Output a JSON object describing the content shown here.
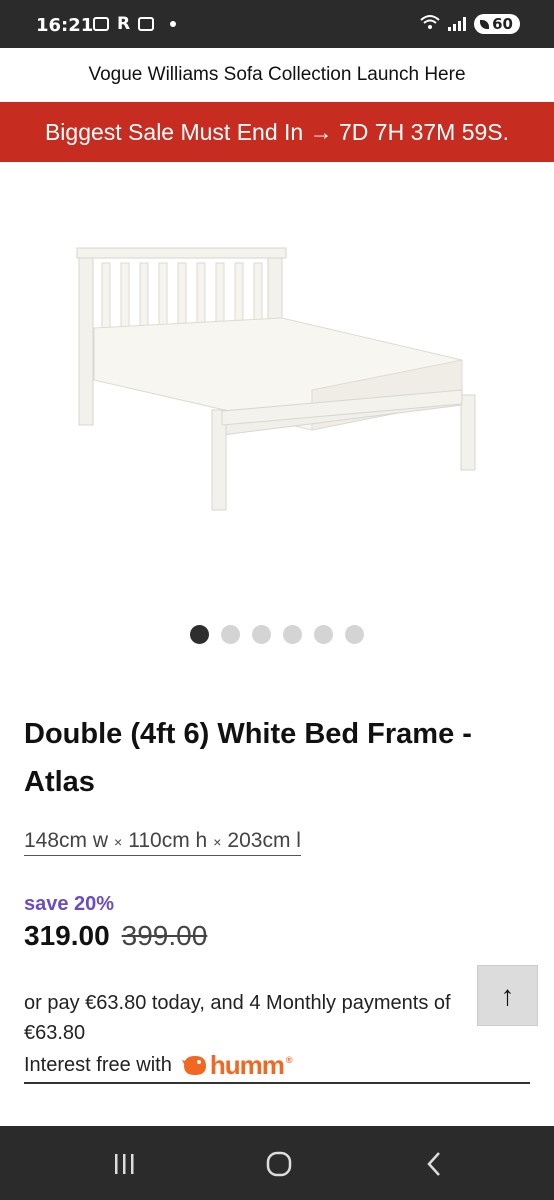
{
  "status_bar": {
    "time": "16:21",
    "r_label": "R",
    "battery": "60"
  },
  "announcement": "Vogue Williams Sofa Collection Launch Here",
  "sale_banner": "Biggest Sale Must End In → 7D 7H 37M 59S.",
  "carousel": {
    "slides": 6,
    "active": 1
  },
  "product": {
    "title": "Double (4ft 6) White Bed Frame - Atlas",
    "dims": {
      "w": "148cm w",
      "h": "110cm h",
      "l": "203cm l",
      "sep": "×"
    },
    "save": "save 20%",
    "price": "319.00",
    "was_price": "399.00"
  },
  "payment": {
    "line1": "or pay €63.80 today, and 4 Monthly payments of",
    "line2": "€63.80",
    "interest_label": "Interest free with",
    "brand": "humm",
    "brand_reg": "®"
  },
  "scroll_top_icon": "arrow-up-icon",
  "scroll_top_glyph": "↑",
  "colors": {
    "sale_bg": "#c62d20",
    "save_text": "#6a4dc4",
    "humm_orange": "#f26722",
    "system_bar": "#2b2b2b"
  }
}
